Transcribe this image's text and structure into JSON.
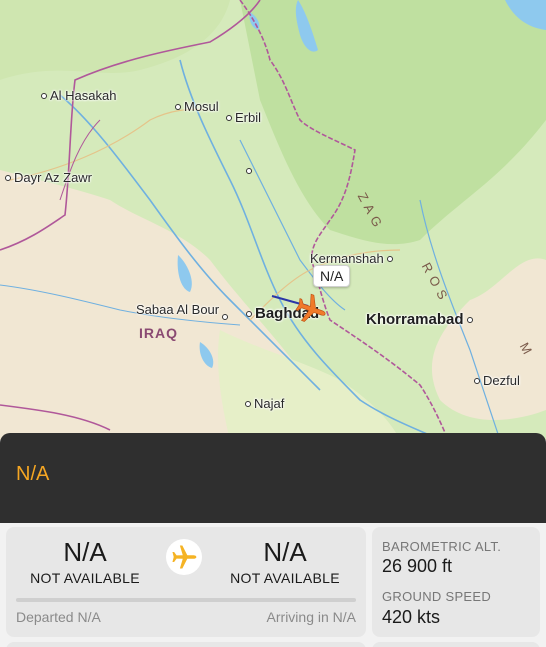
{
  "map": {
    "country_label": "IRAQ",
    "range_label_1": "Z A G",
    "range_label_2": "R O S",
    "range_label_3": "M",
    "flight_tag": "N/A",
    "cities": {
      "al_hasakah": "Al Hasakah",
      "mosul": "Mosul",
      "erbil": "Erbil",
      "dayr_az_zawr": "Dayr Az Zawr",
      "kermanshah": "Kermanshah",
      "sabaa_al_bour": "Sabaa Al Bour",
      "baghdad": "Baghdad",
      "khorramabad": "Khorramabad",
      "dezful": "Dezful",
      "najaf": "Najaf"
    },
    "colors": {
      "land": "#f1e7d3",
      "green": "#cfe7b2",
      "water": "#8ec9ee",
      "border": "#b0589a",
      "aircraft": "#f07a2a"
    }
  },
  "flight": {
    "callsign": "N/A",
    "departure": {
      "code": "N/A",
      "status": "NOT AVAILABLE"
    },
    "arrival": {
      "code": "N/A",
      "status": "NOT AVAILABLE"
    },
    "departed_text": "Departed N/A",
    "arriving_text": "Arriving in N/A",
    "progress": 0
  },
  "stats": {
    "alt_label": "BAROMETRIC ALT.",
    "alt_value": "26 900 ft",
    "speed_label": "GROUND SPEED",
    "speed_value": "420 kts"
  }
}
